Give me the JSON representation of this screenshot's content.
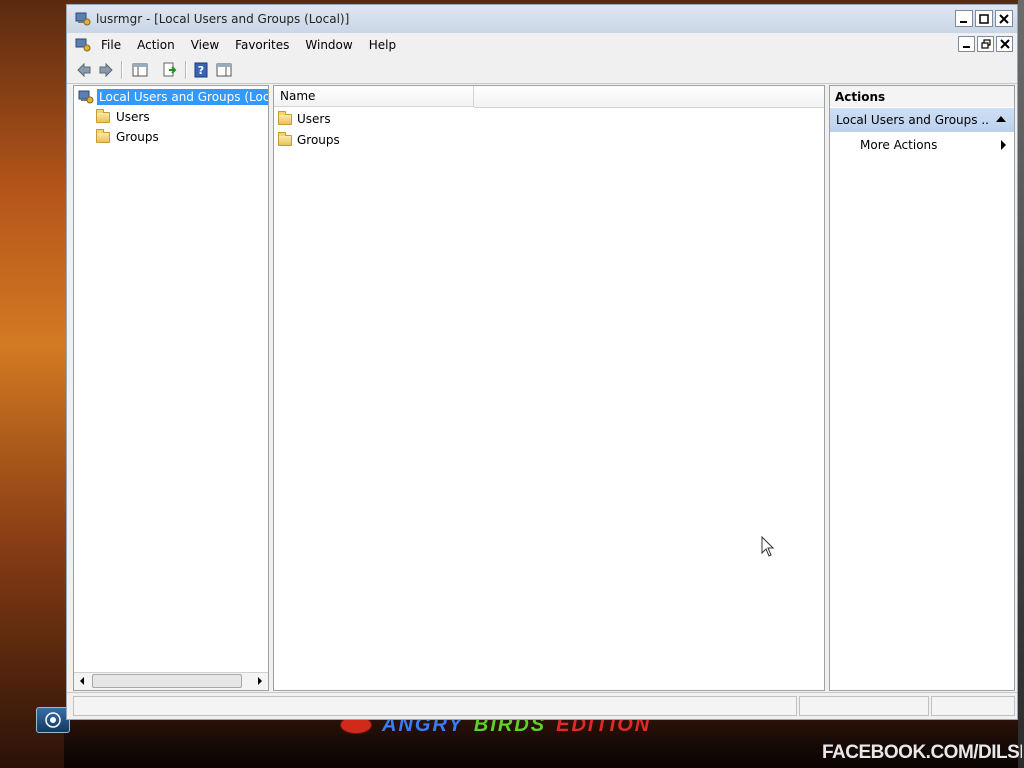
{
  "window": {
    "title": "lusrmgr - [Local Users and Groups (Local)]",
    "controls": [
      "minimize",
      "maximize",
      "close"
    ]
  },
  "menubar": {
    "items": [
      "File",
      "Action",
      "View",
      "Favorites",
      "Window",
      "Help"
    ]
  },
  "toolbar": {
    "buttons": [
      "back",
      "forward",
      "show-hide-console-tree",
      "export-list",
      "help",
      "show-hide-action-pane"
    ]
  },
  "tree": {
    "root_label": "Local Users and Groups (Local)",
    "children": [
      "Users",
      "Groups"
    ]
  },
  "list": {
    "column_name": "Name",
    "items": [
      "Users",
      "Groups"
    ]
  },
  "actions": {
    "header": "Actions",
    "group_label": "Local Users and Groups ...",
    "more_actions": "More Actions"
  },
  "desktop": {
    "watermark": "FACEBOOK.COM/DILSHADSYS",
    "logo_words": [
      "ANGRY",
      "BIRDS",
      "EDITION"
    ]
  },
  "colors": {
    "selection": "#3399ff",
    "actions_group_bg": "#c4d8f1"
  }
}
